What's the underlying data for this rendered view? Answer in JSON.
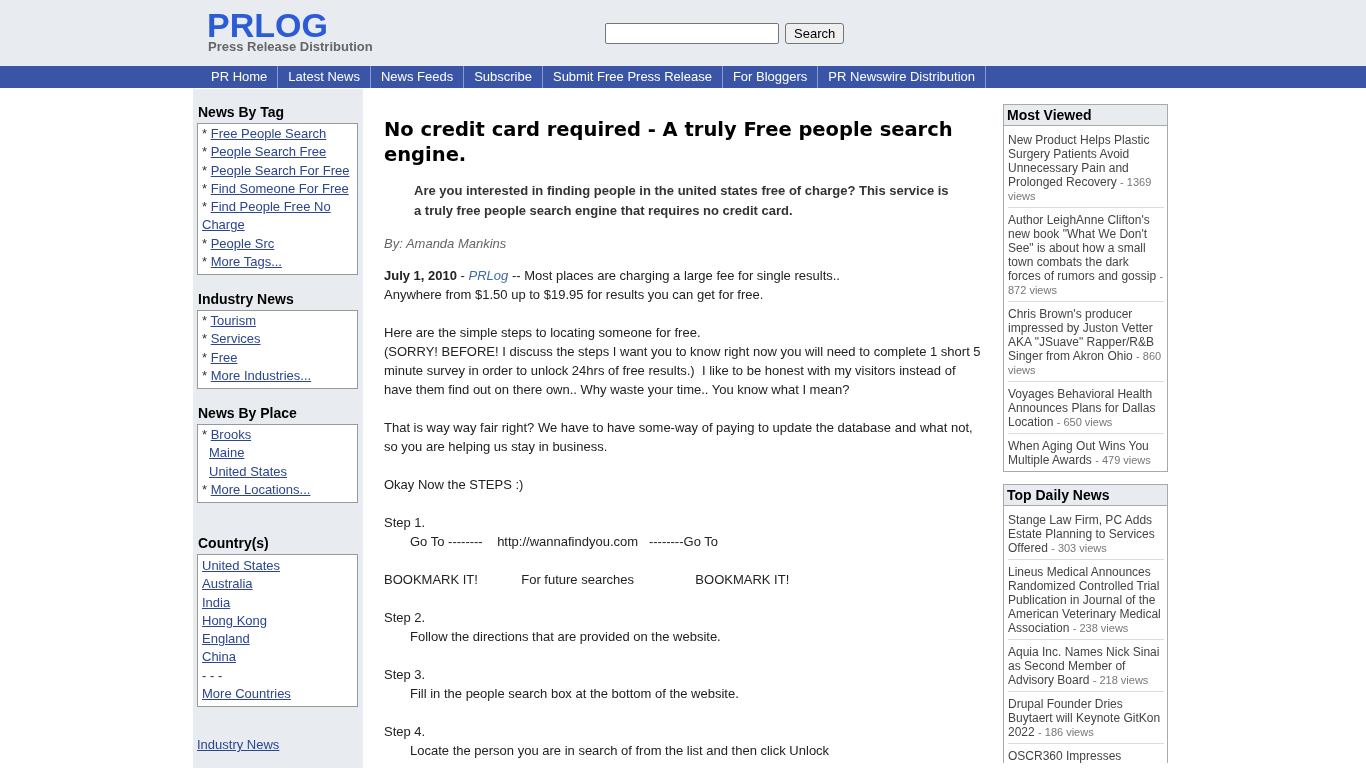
{
  "header": {
    "logo": "PRLOG",
    "tagline": "Press Release Distribution",
    "search": {
      "button": "Search"
    }
  },
  "nav": {
    "items": [
      "PR Home",
      "Latest News",
      "News Feeds",
      "Subscribe",
      "Submit Free Press Release",
      "For Bloggers",
      "PR Newswire Distribution"
    ]
  },
  "sidebar": {
    "sections": [
      {
        "title": "News By Tag",
        "items": [
          {
            "marker": "*",
            "label": "Free People Search"
          },
          {
            "marker": "*",
            "label": "People Search Free"
          },
          {
            "marker": "*",
            "label": "People Search For Free"
          },
          {
            "marker": "*",
            "label": "Find Someone For Free"
          },
          {
            "marker": "*",
            "label": "Find People Free No Charge"
          },
          {
            "marker": "*",
            "label": "People Src"
          },
          {
            "marker": "*",
            "label": "More Tags..."
          }
        ]
      },
      {
        "title": "Industry News",
        "items": [
          {
            "marker": "*",
            "label": "Tourism"
          },
          {
            "marker": "*",
            "label": "Services"
          },
          {
            "marker": "*",
            "label": "Free"
          },
          {
            "marker": "*",
            "label": "More Industries..."
          }
        ]
      },
      {
        "title": "News By Place",
        "items": [
          {
            "marker": "*",
            "label": "Brooks"
          },
          {
            "label": "Maine"
          },
          {
            "label": "United States"
          },
          {
            "marker": "*",
            "label": "More Locations..."
          }
        ]
      }
    ],
    "countries": {
      "title": "Country(s)",
      "items": [
        {
          "kind": "link",
          "label": "United States"
        },
        {
          "kind": "link",
          "label": "Australia"
        },
        {
          "kind": "link",
          "label": "India"
        },
        {
          "kind": "link",
          "label": "Hong Kong"
        },
        {
          "kind": "link",
          "label": "England"
        },
        {
          "kind": "link",
          "label": "China"
        },
        {
          "kind": "text",
          "label": "- - -"
        },
        {
          "kind": "link",
          "label": "More Countries"
        }
      ]
    },
    "footer_link": "Industry News"
  },
  "article": {
    "title": "No credit card required - A truly Free people search engine.",
    "summary": "Are you interested in finding people in the united states free of charge? This service is a truly free people search engine that requires no credit card.",
    "byline": "By: Amanda Mankins",
    "paragraphs": [
      {
        "kind": "dateline",
        "date": "July 1, 2010",
        "dash": "-",
        "source": "PRLog",
        "lines": [
          "-- Most places are charging a large fee for single results..",
          "Anywhere from $1.50 up to $19.95 for results you can get for free."
        ]
      },
      {
        "kind": "text",
        "lines": [
          "Here are the simple steps to locating someone for free.",
          "(SORRY! BEFORE! I discuss the steps I want you to know right now you will need to complete 1 short 5 minute survey in order to unlock 24hrs of free results.)  I like to be honest with my visitors instead of have them find out on there own.. Why waste your time.. You know what I mean?"
        ]
      },
      {
        "kind": "text",
        "lines": [
          "That is way way fair right? We have to have some-way of paying to update the database and what not, so you are helping us stay in business."
        ]
      },
      {
        "kind": "text",
        "lines": [
          "Okay Now the STEPS :)"
        ]
      },
      {
        "kind": "step",
        "title": "Step 1.",
        "detail": "Go To --------    http://wannafindyou.com   --------Go To"
      },
      {
        "kind": "text",
        "lines": [
          "BOOKMARK IT!            For future searches                 BOOKMARK IT!"
        ]
      },
      {
        "kind": "step",
        "title": "Step 2.",
        "detail": "Follow the directions that are provided on the website."
      },
      {
        "kind": "step",
        "title": "Step 3.",
        "detail": "Fill in the people search box at the bottom of the website."
      },
      {
        "kind": "step",
        "title": "Step 4.",
        "detail": "Locate the person you are in search of from the list and then click Unlock"
      }
    ]
  },
  "side_boxes": [
    {
      "title": "Most Viewed",
      "items": [
        {
          "title": "New Product Helps Plastic Surgery Patients Avoid Unnecessary Pain and Prolonged Recovery",
          "views": "- 1369 views"
        },
        {
          "title": "Author LeighAnne Clifton's new book \"What We Don't See\" is about how a small town combats the dark forces of rumors and gossip",
          "views": "- 872 views"
        },
        {
          "title": "Chris Brown's producer impressed by Juston Vetter AKA \"JSuave\" Rapper/R&B Singer from Akron Ohio",
          "views": "- 860 views"
        },
        {
          "title": "Voyages Behavioral Health Announces Plans for Dallas Location",
          "views": "- 650 views"
        },
        {
          "title": "When Aging Out Wins You Multiple Awards",
          "views": "- 479 views"
        }
      ]
    },
    {
      "title": "Top Daily News",
      "items": [
        {
          "title": "Stange Law Firm, PC Adds Estate Planning to Services Offered",
          "views": "- 303 views"
        },
        {
          "title": "Lineus Medical Announces Randomized Controlled Trial Publication in Journal of the American Veterinary Medical Association",
          "views": "- 238 views"
        },
        {
          "title": "Aquia Inc. Names Nick Sinai as Second Member of Advisory Board",
          "views": "- 218 views"
        },
        {
          "title": "Drupal Founder Dries Buytaert will Keynote GitKon 2022",
          "views": "- 186 views"
        },
        {
          "title": "OSCR360 Impresses"
        }
      ]
    }
  ]
}
